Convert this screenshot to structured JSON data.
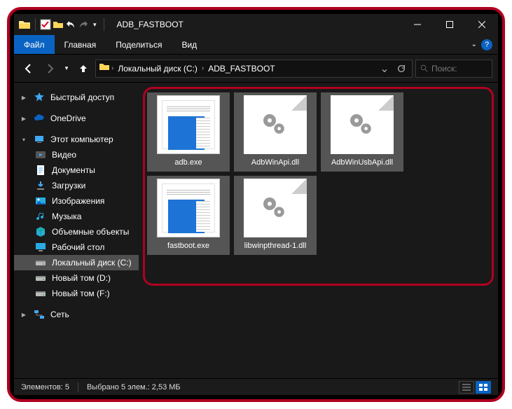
{
  "window": {
    "title": "ADB_FASTBOOT"
  },
  "ribbon": {
    "file": "Файл",
    "tabs": [
      "Главная",
      "Поделиться",
      "Вид"
    ]
  },
  "address": {
    "root": "Локальный диск (C:)",
    "folder": "ADB_FASTBOOT"
  },
  "search": {
    "placeholder": "Поиск:"
  },
  "sidebar": {
    "quick": "Быстрый доступ",
    "onedrive": "OneDrive",
    "thispc": "Этот компьютер",
    "children": [
      {
        "label": "Видео",
        "icon": "video"
      },
      {
        "label": "Документы",
        "icon": "docs"
      },
      {
        "label": "Загрузки",
        "icon": "down"
      },
      {
        "label": "Изображения",
        "icon": "pics"
      },
      {
        "label": "Музыка",
        "icon": "music"
      },
      {
        "label": "Объемные объекты",
        "icon": "3d"
      },
      {
        "label": "Рабочий стол",
        "icon": "desk"
      },
      {
        "label": "Локальный диск (C:)",
        "icon": "disk",
        "selected": true
      },
      {
        "label": "Новый том (D:)",
        "icon": "disk"
      },
      {
        "label": "Новый том (F:)",
        "icon": "disk"
      }
    ],
    "network": "Сеть"
  },
  "files": [
    {
      "name": "adb.exe",
      "type": "exe",
      "selected": true
    },
    {
      "name": "AdbWinApi.dll",
      "type": "dll",
      "selected": true
    },
    {
      "name": "AdbWinUsbApi.dll",
      "type": "dll",
      "selected": true
    },
    {
      "name": "fastboot.exe",
      "type": "exe",
      "selected": true
    },
    {
      "name": "libwinpthread-1.dll",
      "type": "dll",
      "selected": true
    }
  ],
  "status": {
    "count": "Элементов: 5",
    "selected": "Выбрано 5 элем.: 2,53 МБ"
  }
}
